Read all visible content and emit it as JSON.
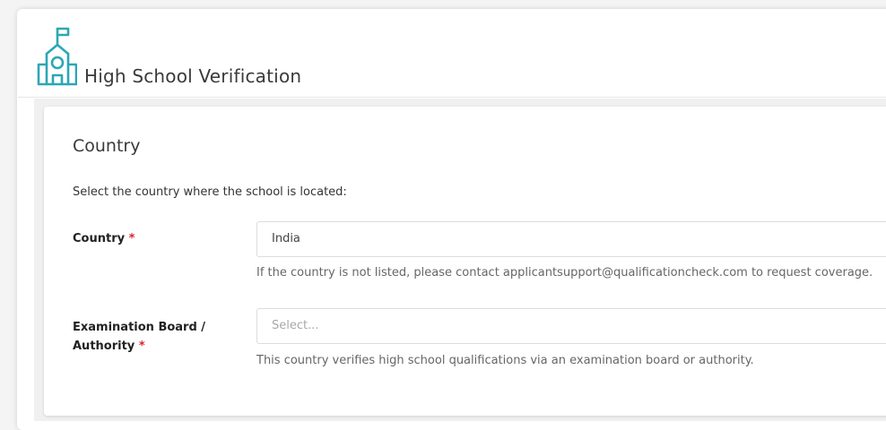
{
  "header": {
    "title": "High School Verification",
    "logo_icon": "school-building-icon",
    "accent_color": "#2ca7b5"
  },
  "section": {
    "title": "Country",
    "instructions": "Select the country where the school is located:"
  },
  "fields": {
    "country": {
      "label": "Country",
      "required_marker": "*",
      "value": "India",
      "help": "If the country is not listed, please contact applicantsupport@qualificationcheck.com to request coverage."
    },
    "exam_board": {
      "label_line1": "Examination Board /",
      "label_line2": "Authority",
      "required_marker": "*",
      "placeholder": "Select...",
      "help": "This country verifies high school qualifications via an examination board or authority."
    }
  }
}
